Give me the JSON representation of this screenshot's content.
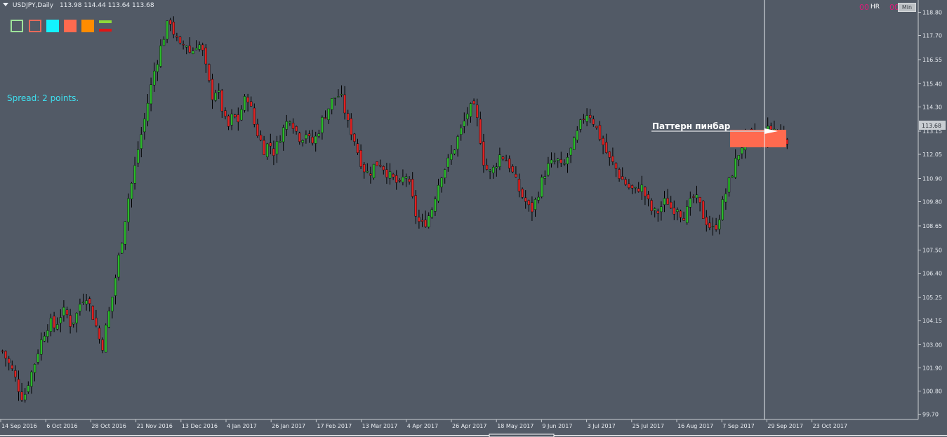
{
  "header": {
    "symbol": "USDJPY,Daily",
    "ohlc": "113.98 114.44 113.64 113.68"
  },
  "spread_text": "Spread: 2 points.",
  "toolbar": {
    "icons": [
      "green-outline-rect-icon",
      "red-outline-rect-icon",
      "cyan-rect-icon",
      "coral-rect-icon",
      "orange-rect-icon",
      "green-red-lines-icon"
    ]
  },
  "indicators": {
    "hr_value": "00",
    "hr_label": "HR",
    "min_value": "00",
    "min_label": "Min"
  },
  "colors": {
    "background": "#525a66",
    "bull": "#2bb82b",
    "bear": "#e02222",
    "wick": "#000000",
    "grid_text": "#e9edf2",
    "zone": "#ff6a4f",
    "spread": "#3ee0f0"
  },
  "chart_data": {
    "type": "candlestick",
    "title": "USDJPY,Daily",
    "last_price": "113.68",
    "ylim": [
      99.45,
      119.05
    ],
    "y_ticks": [
      "118.80",
      "117.70",
      "116.55",
      "115.40",
      "114.30",
      "113.15",
      "112.05",
      "110.90",
      "109.80",
      "108.65",
      "107.50",
      "106.40",
      "105.25",
      "104.15",
      "103.00",
      "101.90",
      "100.80",
      "99.70"
    ],
    "x_ticks": [
      "14 Sep 2016",
      "6 Oct 2016",
      "28 Oct 2016",
      "21 Nov 2016",
      "13 Dec 2016",
      "4 Jan 2017",
      "26 Jan 2017",
      "17 Feb 2017",
      "13 Mar 2017",
      "4 Apr 2017",
      "26 Apr 2017",
      "18 May 2017",
      "9 Jun 2017",
      "3 Jul 2017",
      "25 Jul 2017",
      "16 Aug 2017",
      "7 Sep 2017",
      "29 Sep 2017",
      "23 Oct 2017"
    ],
    "close_path": [
      102.7,
      102.2,
      101.7,
      101.0,
      100.4,
      101.3,
      102.0,
      102.9,
      103.6,
      104.1,
      103.8,
      104.4,
      104.6,
      104.0,
      104.3,
      105.1,
      105.4,
      104.6,
      103.8,
      102.8,
      104.1,
      105.3,
      106.8,
      108.3,
      109.9,
      111.0,
      112.4,
      113.5,
      114.8,
      116.0,
      116.9,
      117.8,
      118.5,
      117.6,
      117.1,
      117.4,
      116.8,
      117.3,
      117.2,
      116.0,
      114.8,
      115.2,
      114.2,
      113.2,
      113.9,
      113.6,
      114.5,
      114.8,
      113.6,
      112.9,
      112.3,
      112.6,
      112.1,
      112.9,
      113.4,
      113.9,
      113.2,
      112.8,
      113.1,
      112.5,
      112.9,
      113.6,
      114.1,
      114.6,
      114.9,
      114.6,
      113.5,
      113.0,
      112.1,
      111.4,
      111.1,
      111.5,
      111.7,
      111.4,
      111.0,
      110.8,
      110.5,
      111.2,
      110.3,
      109.2,
      108.6,
      108.9,
      109.4,
      110.4,
      111.2,
      111.6,
      112.1,
      112.8,
      113.4,
      114.1,
      114.3,
      113.4,
      111.7,
      111.1,
      111.4,
      112.0,
      111.9,
      111.5,
      110.8,
      110.2,
      109.8,
      109.3,
      109.9,
      110.7,
      111.4,
      111.6,
      111.8,
      111.3,
      111.9,
      112.4,
      113.1,
      113.8,
      114.1,
      113.6,
      113.0,
      112.4,
      111.8,
      111.5,
      111.0,
      110.7,
      110.4,
      110.3,
      110.6,
      110.0,
      109.4,
      109.2,
      109.6,
      109.9,
      109.4,
      109.6,
      109.1,
      109.4,
      110.0,
      109.8,
      109.1,
      108.7,
      108.4,
      109.1,
      110.0,
      110.8,
      111.6,
      112.3,
      112.8,
      113.0,
      112.8,
      112.7,
      113.1,
      113.3,
      113.2,
      113.0,
      112.8
    ]
  },
  "annotation": {
    "label": "Паттерн пинбар"
  }
}
